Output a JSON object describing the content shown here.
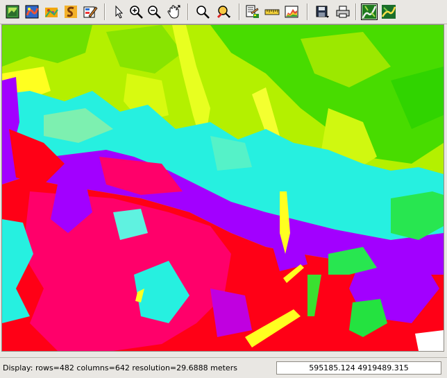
{
  "toolbar": {
    "groups": [
      [
        "display-map-icon",
        "add-raster-icon",
        "add-vector-icon",
        "add-text-icon",
        "overlay-properties-icon"
      ],
      [
        "pointer-icon",
        "zoom-in-icon",
        "zoom-out-icon",
        "pan-icon"
      ],
      [
        "zoom-back-icon",
        "zoom-menu-icon"
      ],
      [
        "query-icon",
        "measure-icon",
        "profile-icon"
      ],
      [
        "save-icon",
        "print-icon"
      ],
      [
        "map-view-icon",
        "3d-view-icon"
      ]
    ]
  },
  "map": {
    "legend_colors": {
      "green": "#48dc00",
      "yellow_green": "#b4f000",
      "yellow": "#ffff20",
      "cyan": "#26f0e0",
      "violet": "#a200ff",
      "red": "#ff0016",
      "magenta": "#ff006a"
    }
  },
  "status": {
    "display_info": "Display: rows=482 columns=642  resolution=29.6888 meters",
    "coordinates": "595185.124 4919489.315"
  }
}
